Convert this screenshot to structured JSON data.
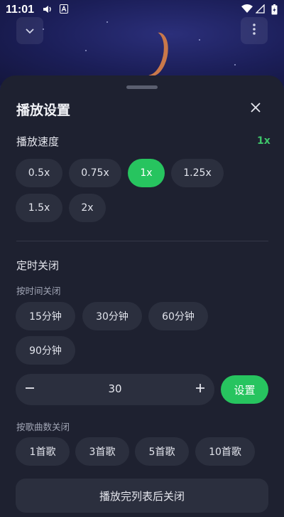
{
  "status": {
    "time": "11:01",
    "icons": [
      "volume-icon",
      "notification-a-icon",
      "wifi-icon",
      "signal-icon",
      "battery-charging-icon"
    ]
  },
  "header": {
    "collapse_icon": "chevron-down-icon",
    "more_icon": "more-vertical-icon"
  },
  "sheet": {
    "title": "播放设置",
    "close_icon": "close-icon",
    "speed": {
      "label": "播放速度",
      "current": "1x",
      "options": [
        "0.5x",
        "0.75x",
        "1x",
        "1.25x",
        "1.5x",
        "2x"
      ],
      "selected": "1x"
    },
    "timer": {
      "label": "定时关闭",
      "by_time_label": "按时间关闭",
      "time_options": [
        "15分钟",
        "30分钟",
        "60分钟",
        "90分钟"
      ],
      "stepper_value": "30",
      "set_button": "设置",
      "by_songs_label": "按歌曲数关闭",
      "song_options": [
        "1首歌",
        "3首歌",
        "5首歌",
        "10首歌"
      ],
      "after_list_button": "播放完列表后关闭"
    }
  },
  "colors": {
    "accent": "#27c45f",
    "sheet_bg": "#1e2130",
    "chip_bg": "#2b2f3e"
  }
}
